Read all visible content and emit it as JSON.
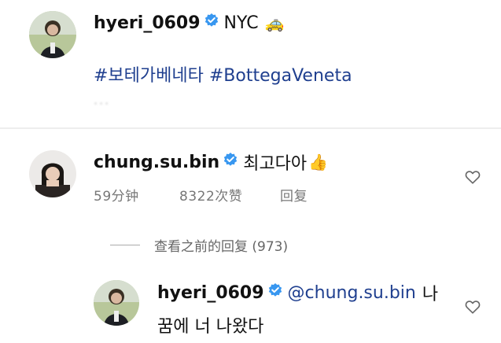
{
  "post": {
    "username": "hyeri_0609",
    "location_text": "NYC",
    "taxi_emoji": "🚕",
    "hashtags": "#보테가베네타 #BottegaVeneta",
    "faded_text": "···"
  },
  "comment": {
    "username": "chung.su.bin",
    "text": "최고다아",
    "thumbs_emoji": "👍",
    "time": "59分钟",
    "likes": "8322次赞",
    "reply_label": "回复"
  },
  "replies_toggle": {
    "label": "查看之前的回复 (973)"
  },
  "reply": {
    "username": "hyeri_0609",
    "mention": "@chung.su.bin",
    "text_line1_suffix": "나",
    "text_line2": "꿈에 너 나왔다"
  },
  "icons": {
    "verified": "verified-badge-icon",
    "heart": "heart-outline-icon"
  },
  "colors": {
    "verified": "#3897f0",
    "hashtag": "#1f3f8f",
    "meta": "#777777"
  }
}
